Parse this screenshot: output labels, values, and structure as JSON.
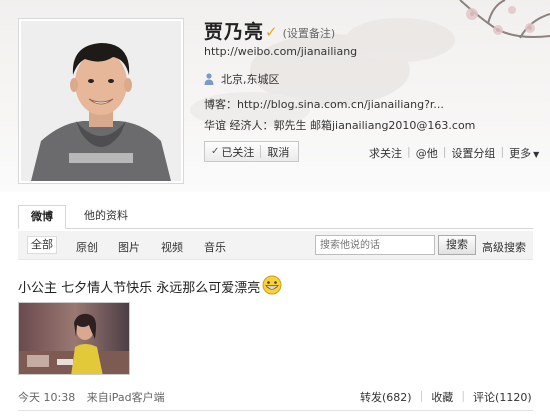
{
  "profile": {
    "name": "贾乃亮",
    "verified_icon": "v-verified-icon",
    "remark_label": "(设置备注)",
    "url": "http://weibo.com/jianailiang",
    "location": "北京,东城区",
    "blog": "博客：http://blog.sina.com.cn/jianailiang?r...",
    "agent": "华谊  经济人：郭先生 邮箱jianailiang2010@163.com",
    "follow_status": "已关注",
    "follow_tick": "✓",
    "unfollow_label": "取消"
  },
  "actions": {
    "ask_follow": "求关注",
    "mention": "@他",
    "set_group": "设置分组",
    "more": "更多",
    "more_caret": "▼"
  },
  "tabs": [
    "微博",
    "他的资料"
  ],
  "filters": {
    "all": "全部",
    "original": "原创",
    "pictures": "图片",
    "videos": "视频",
    "music": "音乐",
    "search_placeholder": "搜索他说的话",
    "search_button": "搜索",
    "advanced_search": "高级搜索"
  },
  "post": {
    "text": "小公主 七夕情人节快乐 永远那么可爱漂亮",
    "emoji": "grin-emoticon-icon",
    "time": "今天 10:38",
    "source": "来自iPad客户端",
    "repost": "转发(682)",
    "favorite": "收藏",
    "comment": "评论(1120)"
  },
  "colors": {
    "verified": "#e8a818",
    "link": "#333333"
  }
}
